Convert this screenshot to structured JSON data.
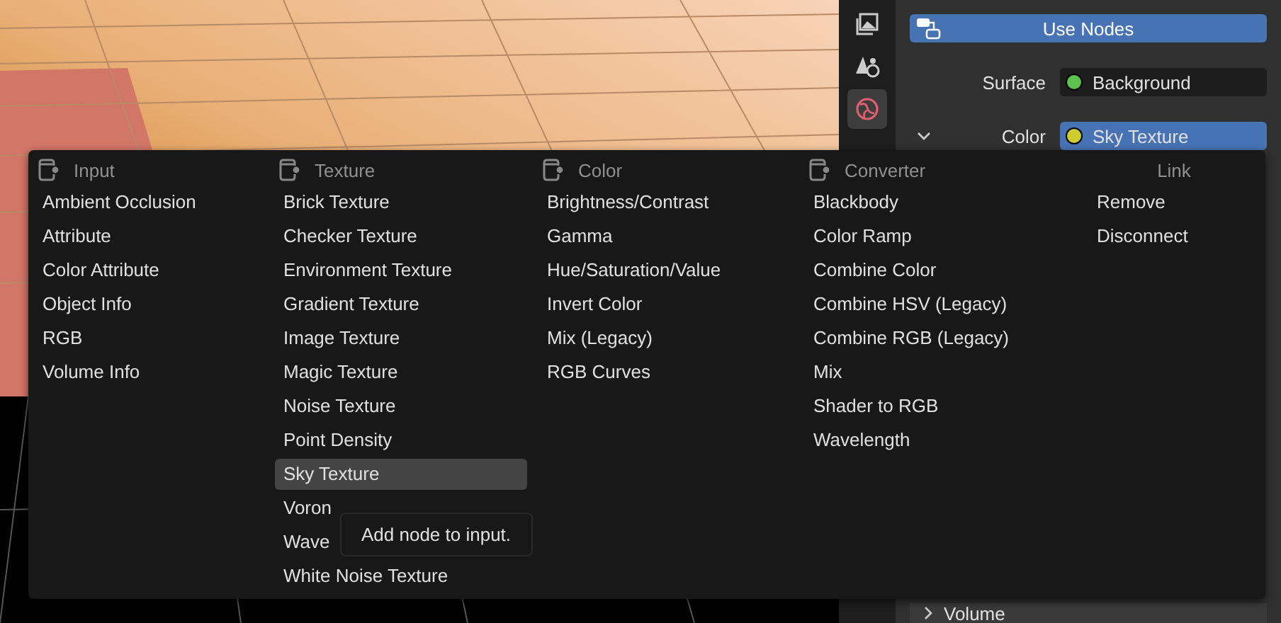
{
  "property_tabs": [
    {
      "selected": false
    },
    {
      "selected": false
    },
    {
      "selected": true
    }
  ],
  "use_nodes": {
    "label": "Use Nodes"
  },
  "properties": [
    {
      "label": "Surface",
      "value": "Background",
      "color": "#5cc14f",
      "selected": false
    },
    {
      "label": "Color",
      "value": "Sky Texture",
      "color": "#cdcd30",
      "selected": true,
      "expanded": true
    }
  ],
  "panels": [
    {
      "label": "Volume",
      "expanded": false
    }
  ],
  "menu": {
    "columns": [
      {
        "title": "Input",
        "kind": "category",
        "items": [
          {
            "label": "Ambient Occlusion",
            "selected": false
          },
          {
            "label": "Attribute",
            "selected": false
          },
          {
            "label": "Color Attribute",
            "selected": false
          },
          {
            "label": "Object Info",
            "selected": false
          },
          {
            "label": "RGB",
            "selected": false
          },
          {
            "label": "Volume Info",
            "selected": false
          }
        ]
      },
      {
        "title": "Texture",
        "kind": "category",
        "items": [
          {
            "label": "Brick Texture",
            "selected": false
          },
          {
            "label": "Checker Texture",
            "selected": false
          },
          {
            "label": "Environment Texture",
            "selected": false
          },
          {
            "label": "Gradient Texture",
            "selected": false
          },
          {
            "label": "Image Texture",
            "selected": false
          },
          {
            "label": "Magic Texture",
            "selected": false
          },
          {
            "label": "Noise Texture",
            "selected": false
          },
          {
            "label": "Point Density",
            "selected": false
          },
          {
            "label": "Sky Texture",
            "selected": true
          },
          {
            "label": "Voron",
            "selected": false
          },
          {
            "label": "Wave",
            "selected": false
          },
          {
            "label": "White Noise Texture",
            "selected": false
          }
        ]
      },
      {
        "title": "Color",
        "kind": "category",
        "items": [
          {
            "label": "Brightness/Contrast",
            "selected": false
          },
          {
            "label": "Gamma",
            "selected": false
          },
          {
            "label": "Hue/Saturation/Value",
            "selected": false
          },
          {
            "label": "Invert Color",
            "selected": false
          },
          {
            "label": "Mix (Legacy)",
            "selected": false
          },
          {
            "label": "RGB Curves",
            "selected": false
          }
        ]
      },
      {
        "title": "Converter",
        "kind": "category",
        "items": [
          {
            "label": "Blackbody",
            "selected": false
          },
          {
            "label": "Color Ramp",
            "selected": false
          },
          {
            "label": "Combine Color",
            "selected": false
          },
          {
            "label": "Combine HSV (Legacy)",
            "selected": false
          },
          {
            "label": "Combine RGB (Legacy)",
            "selected": false
          },
          {
            "label": "Mix",
            "selected": false
          },
          {
            "label": "Shader to RGB",
            "selected": false
          },
          {
            "label": "Wavelength",
            "selected": false
          }
        ]
      },
      {
        "title": "Link",
        "kind": "operation",
        "items": [
          {
            "label": "Remove",
            "selected": false
          },
          {
            "label": "Disconnect",
            "selected": false
          }
        ]
      }
    ],
    "tooltip": {
      "text": "Add node to input."
    }
  }
}
